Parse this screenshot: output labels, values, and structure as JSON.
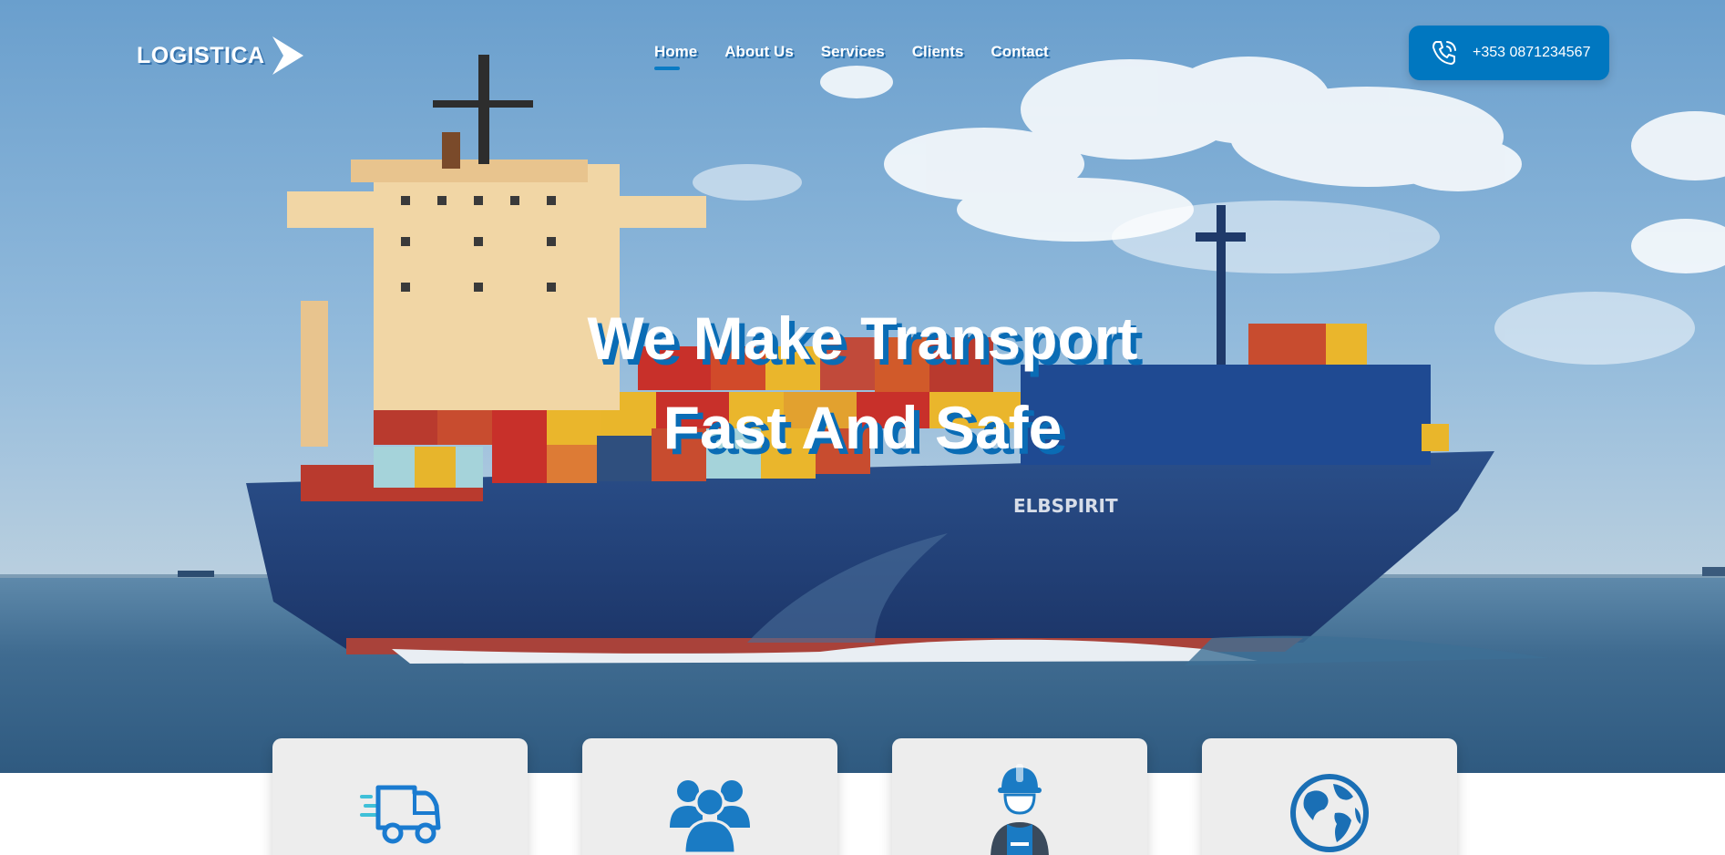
{
  "header": {
    "logo_text": "LOGISTICA",
    "nav": [
      {
        "label": "Home",
        "active": true
      },
      {
        "label": "About Us",
        "active": false
      },
      {
        "label": "Services",
        "active": false
      },
      {
        "label": "Clients",
        "active": false
      },
      {
        "label": "Contact",
        "active": false
      }
    ],
    "phone": "+353 0871234567"
  },
  "hero": {
    "headline_line1": "We Make Transport",
    "headline_line2": "Fast And Safe",
    "ship_name": "ELBSPIRIT"
  },
  "cards": [
    {
      "icon": "delivery-truck-icon"
    },
    {
      "icon": "team-users-icon"
    },
    {
      "icon": "worker-helmet-icon"
    },
    {
      "icon": "globe-icon"
    }
  ],
  "colors": {
    "accent": "#0077c0",
    "headline_shadow": "#0a6cb5",
    "card_bg": "#ededed"
  }
}
